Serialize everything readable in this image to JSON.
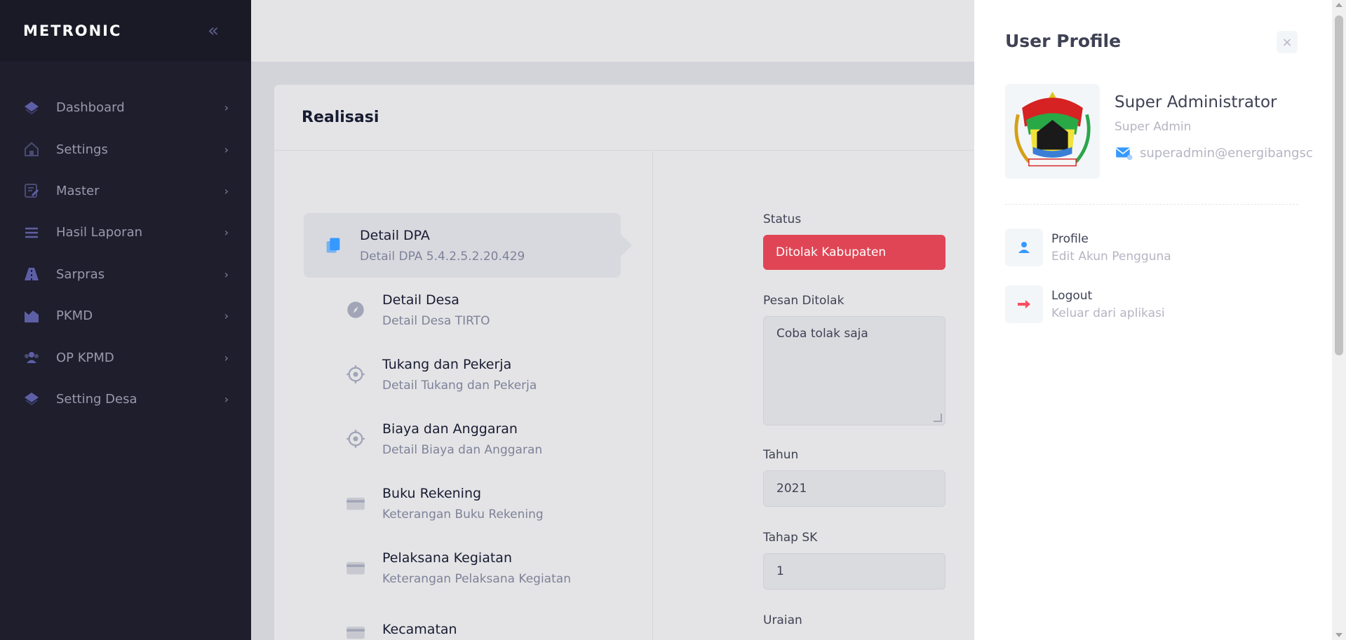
{
  "brand": {
    "name": "METRONIC",
    "toggle_icon": "double-chevron-left-icon"
  },
  "sidebar": {
    "items": [
      {
        "label": "Dashboard",
        "icon": "layers-icon"
      },
      {
        "label": "Settings",
        "icon": "home-icon"
      },
      {
        "label": "Master",
        "icon": "edit-icon"
      },
      {
        "label": "Hasil Laporan",
        "icon": "list-icon"
      },
      {
        "label": "Sarpras",
        "icon": "road-icon"
      },
      {
        "label": "PKMD",
        "icon": "chart-icon"
      },
      {
        "label": "OP KPMD",
        "icon": "group-icon"
      },
      {
        "label": "Setting Desa",
        "icon": "layers-icon"
      }
    ]
  },
  "card": {
    "title": "Realisasi"
  },
  "steps": [
    {
      "title": "Detail DPA",
      "desc": "Detail DPA 5.4.2.5.2.20.429",
      "icon": "copy-icon",
      "active": true
    },
    {
      "title": "Detail Desa",
      "desc": "Detail Desa TIRTO",
      "icon": "compass-icon"
    },
    {
      "title": "Tukang dan Pekerja",
      "desc": "Detail Tukang dan Pekerja",
      "icon": "target-icon"
    },
    {
      "title": "Biaya dan Anggaran",
      "desc": "Detail Biaya dan Anggaran",
      "icon": "target-icon"
    },
    {
      "title": "Buku Rekening",
      "desc": "Keterangan Buku Rekening",
      "icon": "credit-card-icon"
    },
    {
      "title": "Pelaksana Kegiatan",
      "desc": "Keterangan Pelaksana Kegiatan",
      "icon": "credit-card-icon"
    },
    {
      "title": "Kecamatan",
      "desc": "",
      "icon": "credit-card-icon"
    }
  ],
  "form": {
    "status_label": "Status",
    "status_value": "Ditolak Kabupaten",
    "pesan_label": "Pesan Ditolak",
    "pesan_value": "Coba tolak saja",
    "tahun_label": "Tahun",
    "tahun_value": "2021",
    "tahap_label": "Tahap SK",
    "tahap_value": "1",
    "uraian_label": "Uraian"
  },
  "profile": {
    "title": "User Profile",
    "close_label": "×",
    "name": "Super Administrator",
    "role": "Super Admin",
    "email": "superadmin@energibangsc",
    "nav": [
      {
        "title": "Profile",
        "desc": "Edit Akun Pengguna",
        "icon": "user-icon",
        "color": "#3699ff"
      },
      {
        "title": "Logout",
        "desc": "Keluar dari aplikasi",
        "icon": "arrow-right-icon",
        "color": "#f64e60"
      }
    ]
  },
  "colors": {
    "sidebar": "#1e1e2d",
    "danger": "#e04555",
    "primary": "#3699ff"
  }
}
